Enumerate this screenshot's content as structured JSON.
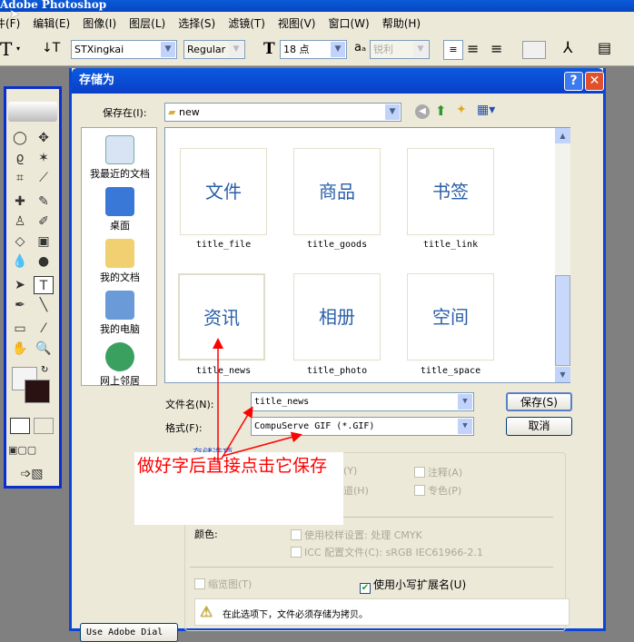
{
  "app": {
    "title": "Adobe Photoshop"
  },
  "menu": [
    "件(F)",
    "编辑(E)",
    "图像(I)",
    "图层(L)",
    "选择(S)",
    "滤镜(T)",
    "视图(V)",
    "窗口(W)",
    "帮助(H)"
  ],
  "options": {
    "tool_glyph": "T",
    "font_family": "STXingkai",
    "font_style": "Regular",
    "font_size": "18 点",
    "antialias": "锐利"
  },
  "dialog": {
    "title": "存储为",
    "save_in_label": "保存在(I):",
    "save_in_value": "new",
    "places": [
      "我最近的文档",
      "桌面",
      "我的文档",
      "我的电脑",
      "网上邻居"
    ],
    "files": [
      {
        "thumb": "文件",
        "name": "title_file"
      },
      {
        "thumb": "商品",
        "name": "title_goods"
      },
      {
        "thumb": "书签",
        "name": "title_link"
      },
      {
        "thumb": "资讯",
        "name": "title_news"
      },
      {
        "thumb": "相册",
        "name": "title_photo"
      },
      {
        "thumb": "空间",
        "name": "title_space"
      }
    ],
    "filename_label": "文件名(N):",
    "filename_value": "title_news",
    "format_label": "格式(F):",
    "format_value": "CompuServe GIF (*.GIF)",
    "save_button": "保存(S)",
    "cancel_button": "取消",
    "options_group_label": "存储选项",
    "opt_partial1": "(Y)",
    "opt_partial2": "道(H)",
    "annotations_opt": "注释(A)",
    "spot_opt": "专色(P)",
    "color_label": "颜色:",
    "proof_opt": "使用校样设置: 处理 CMYK",
    "icc_opt": "ICC 配置文件(C): sRGB IEC61966-2.1",
    "thumbnail_opt": "缩览图(T)",
    "lowercase_opt": "使用小写扩展名(U)",
    "lowercase_checked": true,
    "warning": "在此选项下，文件必须存储为拷贝。",
    "adobe_dialog_button": "Use Adobe Dial"
  },
  "annotation": {
    "text": "做好字后直接点击它保存",
    "color": "#ff0000"
  }
}
